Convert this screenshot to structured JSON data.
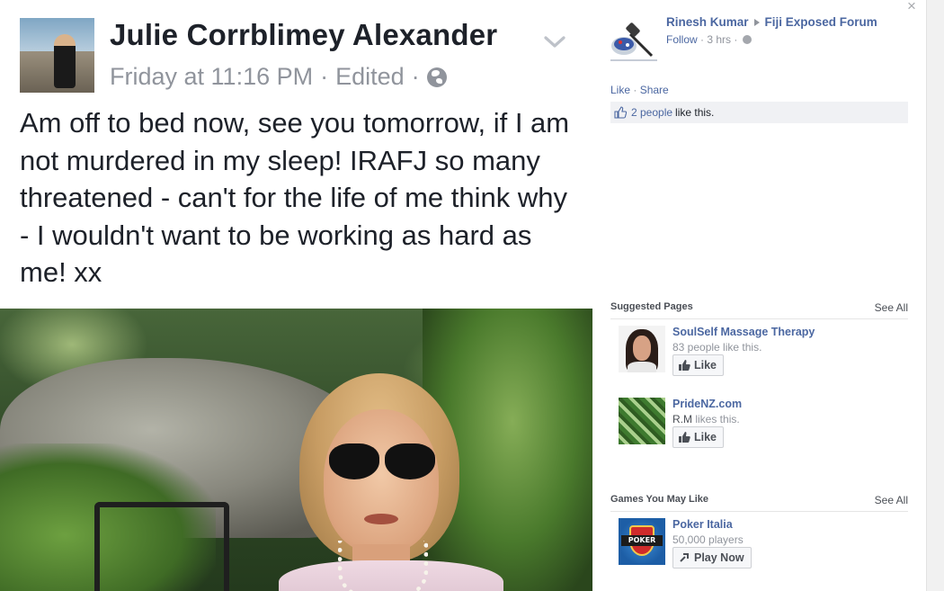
{
  "post": {
    "author": "Julie Corrblimey Alexander",
    "timestamp": "Friday at 11:16 PM",
    "edited": "Edited",
    "separator": "·",
    "text": "Am off to bed now, see you tomorrow, if I am not murdered in my sleep! IRAFJ so many threatened - can't for the life of me think why - I wouldn't want to be working as hard as me! xx",
    "privacy_icon": "globe-icon",
    "menu_icon": "chevron-down-icon"
  },
  "right_panel": {
    "close_glyph": "×",
    "activity": {
      "user": "Rinesh Kumar",
      "group": "Fiji Exposed Forum",
      "follow": "Follow",
      "time": "3 hrs",
      "separator": "·",
      "like": "Like",
      "share": "Share",
      "likes_link": "2 people",
      "likes_suffix": "like this."
    },
    "suggested_pages": {
      "title": "Suggested Pages",
      "see_all": "See All",
      "items": [
        {
          "name": "SoulSelf Massage Therapy",
          "subtitle": "83 people like this.",
          "subtitle_prefix": "",
          "button": "Like"
        },
        {
          "name": "PrideNZ.com",
          "subtitle_prefix": "R.M",
          "subtitle": "likes this.",
          "button": "Like"
        }
      ]
    },
    "games": {
      "title": "Games You May Like",
      "see_all": "See All",
      "items": [
        {
          "name": "Poker Italia",
          "subtitle": "50,000 players",
          "button": "Play Now",
          "logo_text": "POKER"
        }
      ]
    }
  },
  "colors": {
    "link_blue": "#4b67a1",
    "meta_grey": "#90949c",
    "text_dark": "#1d2129"
  }
}
